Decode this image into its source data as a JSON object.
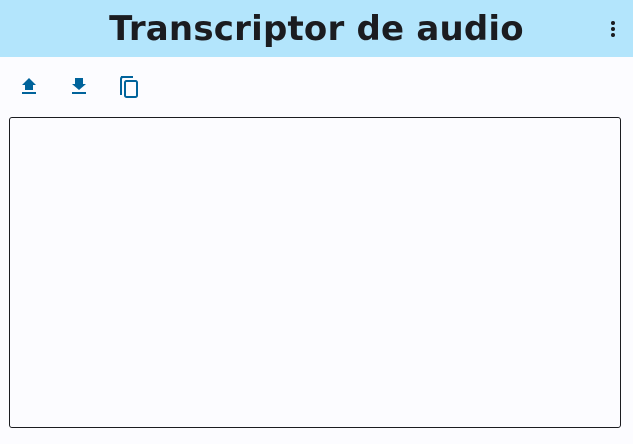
{
  "app": {
    "title": "Transcriptor de audio"
  },
  "header": {
    "menu_icon": "more-vert-icon"
  },
  "toolbar": {
    "buttons": [
      {
        "icon": "upload-icon"
      },
      {
        "icon": "download-icon"
      },
      {
        "icon": "copy-icon"
      }
    ]
  },
  "transcript": {
    "value": "",
    "placeholder": ""
  },
  "colors": {
    "header_background": "#b3e5fc",
    "page_background": "#fcfcff",
    "icon_color": "#00639b",
    "title_color": "#1b1c20",
    "border_color": "#1b1c20"
  }
}
